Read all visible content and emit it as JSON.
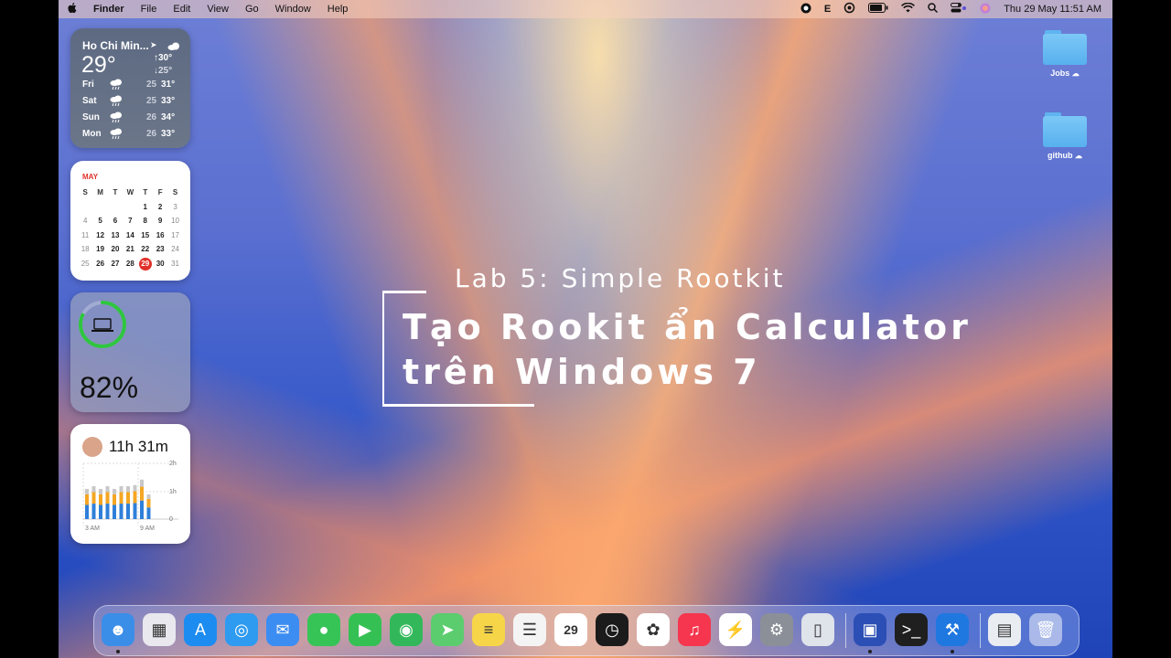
{
  "menubar": {
    "app_name": "Finder",
    "menus": [
      "File",
      "Edit",
      "View",
      "Go",
      "Window",
      "Help"
    ],
    "status_icons": [
      "record-icon",
      "keyboard-input-icon",
      "extension-icon",
      "battery-icon",
      "wifi-icon",
      "search-icon",
      "control-center-icon",
      "siri-icon"
    ],
    "input_label": "E",
    "datetime": "Thu 29 May  11:51 AM"
  },
  "weather": {
    "city": "Ho Chi Min...",
    "current_temp": "29°",
    "high": "↑30°",
    "low": "↓25°",
    "forecast": [
      {
        "day": "Fri",
        "low": "25",
        "high": "31°"
      },
      {
        "day": "Sat",
        "low": "25",
        "high": "33°"
      },
      {
        "day": "Sun",
        "low": "26",
        "high": "34°"
      },
      {
        "day": "Mon",
        "low": "26",
        "high": "33°"
      }
    ]
  },
  "calendar": {
    "month": "MAY",
    "weekdays": [
      "S",
      "M",
      "T",
      "W",
      "T",
      "F",
      "S"
    ],
    "days": [
      "",
      "",
      "",
      "",
      "1",
      "2",
      "3",
      "4",
      "5",
      "6",
      "7",
      "8",
      "9",
      "10",
      "11",
      "12",
      "13",
      "14",
      "15",
      "16",
      "17",
      "18",
      "19",
      "20",
      "21",
      "22",
      "23",
      "24",
      "25",
      "26",
      "27",
      "28",
      "29",
      "30",
      "31"
    ],
    "today": "29"
  },
  "battery": {
    "percent_label": "82%",
    "level": 0.82,
    "ring_color": "#2fc63f"
  },
  "screentime": {
    "total": "11h 31m",
    "y_labels": [
      "2h",
      "1h",
      "0"
    ],
    "x_labels": [
      "3 AM",
      "9 AM"
    ],
    "bar_colors": {
      "blue": "#2f7fd9",
      "orange": "#f5a623",
      "gray": "#c8c8c8"
    }
  },
  "slide": {
    "subtitle": "Lab 5: Simple Rootkit",
    "title_line1": "Tạo Rookit ẩn Calculator",
    "title_line2": "trên Windows 7"
  },
  "desktop_icons": [
    {
      "label": "Jobs"
    },
    {
      "label": "github"
    }
  ],
  "dock": {
    "apps": [
      {
        "name": "finder",
        "color": "#3b8ee8",
        "glyph": "☻",
        "running": true
      },
      {
        "name": "launchpad",
        "color": "#e8e8ee",
        "glyph": "▦",
        "running": false
      },
      {
        "name": "app-store",
        "color": "#1c8cf0",
        "glyph": "A",
        "running": false
      },
      {
        "name": "safari",
        "color": "#2e9af0",
        "glyph": "◎",
        "running": false
      },
      {
        "name": "mail",
        "color": "#3c8df2",
        "glyph": "✉",
        "running": false
      },
      {
        "name": "messages",
        "color": "#36c457",
        "glyph": "●",
        "running": false
      },
      {
        "name": "facetime",
        "color": "#35c054",
        "glyph": "▶",
        "running": false
      },
      {
        "name": "find-my",
        "color": "#32b85a",
        "glyph": "◉",
        "running": false
      },
      {
        "name": "maps",
        "color": "#5ccd6f",
        "glyph": "➤",
        "running": false
      },
      {
        "name": "notes",
        "color": "#f7d548",
        "glyph": "≡",
        "running": false
      },
      {
        "name": "reminders",
        "color": "#f4f4f4",
        "glyph": "☰",
        "running": false
      },
      {
        "name": "calendar",
        "color": "#ffffff",
        "glyph": "29",
        "running": false
      },
      {
        "name": "clock",
        "color": "#1b1b1b",
        "glyph": "◷",
        "running": false
      },
      {
        "name": "photos",
        "color": "#ffffff",
        "glyph": "✿",
        "running": false
      },
      {
        "name": "music",
        "color": "#f5364e",
        "glyph": "♫",
        "running": false
      },
      {
        "name": "messenger",
        "color": "#ffffff",
        "glyph": "⚡",
        "running": false
      },
      {
        "name": "system-settings",
        "color": "#8b8f98",
        "glyph": "⚙",
        "running": false
      },
      {
        "name": "iphone-mirroring",
        "color": "#dfe3ea",
        "glyph": "▯",
        "running": false
      },
      {
        "name": "screen-sharing",
        "color": "#2b4fb5",
        "glyph": "▣",
        "running": true
      },
      {
        "name": "terminal",
        "color": "#1f1f1f",
        "glyph": ">_",
        "running": false
      },
      {
        "name": "xcode",
        "color": "#1f78e0",
        "glyph": "⚒",
        "running": true
      },
      {
        "name": "archive-utility",
        "color": "#e9ecf1",
        "glyph": "▤",
        "running": false
      },
      {
        "name": "trash",
        "color": "rgba(255,255,255,0.5)",
        "glyph": "🗑",
        "running": false
      }
    ]
  }
}
